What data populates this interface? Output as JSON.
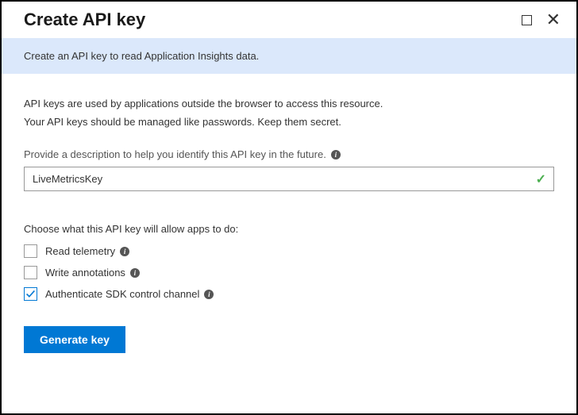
{
  "header": {
    "title": "Create API key"
  },
  "banner": {
    "text": "Create an API key to read Application Insights data."
  },
  "description": {
    "line1": "API keys are used by applications outside the browser to access this resource.",
    "line2": "Your API keys should be managed like passwords. Keep them secret."
  },
  "form": {
    "description_label": "Provide a description to help you identify this API key in the future.",
    "description_value": "LiveMetricsKey"
  },
  "permissions": {
    "title": "Choose what this API key will allow apps to do:",
    "items": [
      {
        "label": "Read telemetry",
        "checked": false
      },
      {
        "label": "Write annotations",
        "checked": false
      },
      {
        "label": "Authenticate SDK control channel",
        "checked": true
      }
    ]
  },
  "actions": {
    "generate": "Generate key"
  }
}
